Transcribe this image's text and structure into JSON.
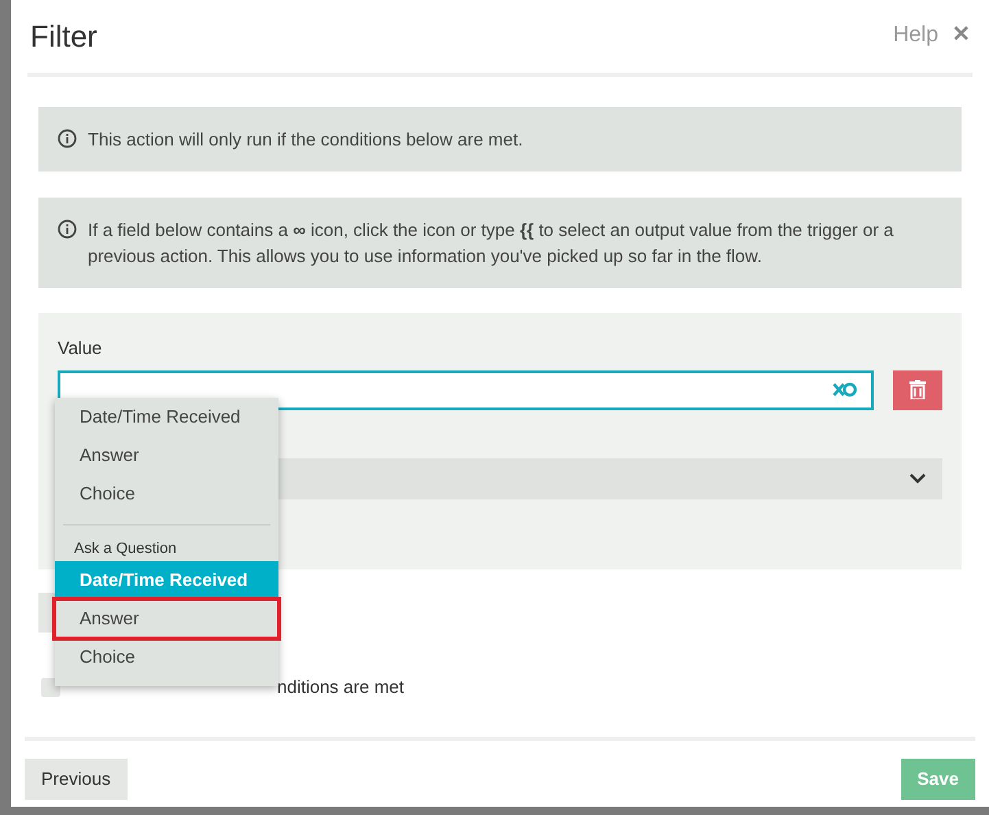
{
  "dialog": {
    "title": "Filter",
    "help": "Help",
    "close": "✕"
  },
  "notices": [
    {
      "text": "This action will only run if the conditions below are met."
    },
    {
      "text": "If a field below contains a **∞** icon, click the icon or type **{{** to select an output value from the trigger or a previous action. This allows you to use information you've picked up so far in the flow."
    }
  ],
  "condition": {
    "label": "Value",
    "focused": true
  },
  "dropdown": {
    "groups": [
      {
        "items": [
          {
            "label": "Date/Time Received",
            "selected": false,
            "highlighted": false
          },
          {
            "label": "Answer",
            "selected": false,
            "highlighted": false
          },
          {
            "label": "Choice",
            "selected": false,
            "highlighted": false
          }
        ]
      },
      {
        "header": "Ask a Question",
        "items": [
          {
            "label": "Date/Time Received",
            "selected": true,
            "highlighted": false
          },
          {
            "label": "Answer",
            "selected": false,
            "highlighted": true
          },
          {
            "label": "Choice",
            "selected": false,
            "highlighted": false
          }
        ]
      }
    ]
  },
  "option": {
    "text": "nditions are met",
    "checked": false
  },
  "footer": {
    "previous": "Previous",
    "save": "Save"
  }
}
